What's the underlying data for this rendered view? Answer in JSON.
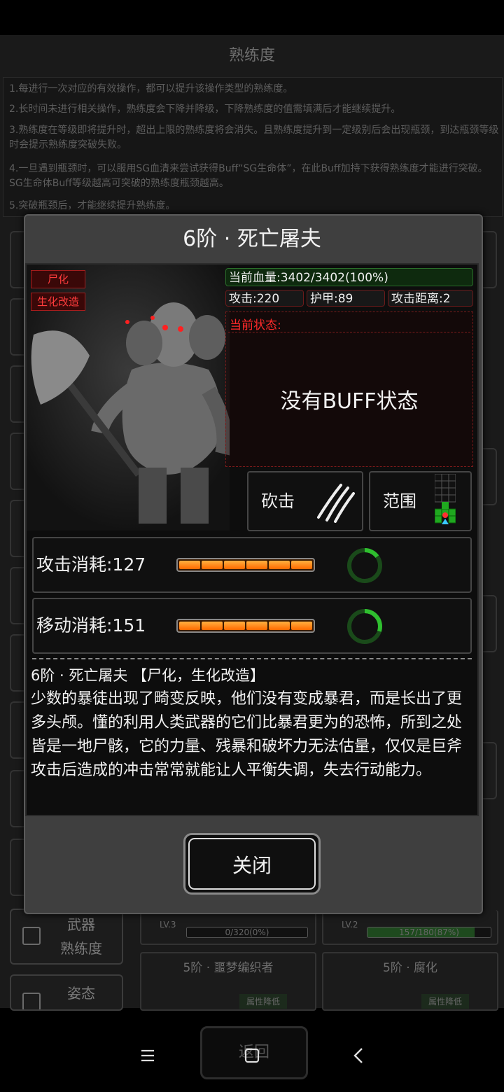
{
  "background": {
    "title": "熟练度",
    "rules": [
      "1.每进行一次对应的有效操作，都可以提升该操作类型的熟练度。",
      "2.长时间未进行相关操作，熟练度会下降并降级，下降熟练度的值需填满后才能继续提升。",
      "3.熟练度在等级即将提升时，超出上限的熟练度将会消失。且熟练度提升到一定级别后会出现瓶颈，到达瓶颈等级时会提示熟练度突破失败。",
      "4.一旦遇到瓶颈时，可以服用SG血清来尝试获得Buff“SG生命体”，在此Buff加持下获得熟练度才能进行突破。SG生命体Buff等级越高可突破的熟练度瓶颈越高。",
      "5.突破瓶颈后，才能继续提升熟练度。"
    ],
    "tabs": [
      {
        "line1": "武器",
        "line2": "熟练度"
      },
      {
        "line1": "姿态",
        "line2": ""
      }
    ],
    "cards": [
      {
        "level": "LV.3",
        "progress_text": "0/320(0%)",
        "progress": 0
      },
      {
        "level": "LV.2",
        "progress_text": "157/180(87%)",
        "progress": 0.87
      }
    ],
    "next_cards": [
      {
        "name": "5阶 · 噩梦编织者",
        "tag": "属性降低"
      },
      {
        "name": "5阶 · 腐化",
        "tag": "属性降低"
      }
    ],
    "return_label": "返回"
  },
  "modal": {
    "title": "6阶 · 死亡屠夫",
    "tags": [
      "尸化",
      "生化改造"
    ],
    "hp": "当前血量:3402/3402(100%)",
    "stats": {
      "attack": "攻击:220",
      "armor": "护甲:89",
      "range": "攻击距离:2"
    },
    "state_label": "当前状态:",
    "no_buff": "没有BUFF状态",
    "skills": {
      "attack_type": "砍击",
      "range_label": "范围"
    },
    "costs": [
      {
        "label": "攻击消耗:127",
        "ring_fill": 0.15
      },
      {
        "label": "移动消耗:151",
        "ring_fill": 0.3
      }
    ],
    "desc_title": "6阶 · 死亡屠夫 【尸化，生化改造】",
    "desc": "少数的暴徒出现了畸变反映，他们没有变成暴君，而是长出了更多头颅。懂的利用人类武器的它们比暴君更为的恐怖，所到之处皆是一地尸骸，它的力量、残暴和破坏力无法估量，仅仅是巨斧攻击后造成的冲击常常就能让人平衡失调，失去行动能力。",
    "close_label": "关闭"
  },
  "colors": {
    "accent_red": "#ff2a2a",
    "hp_green": "#2a6e2a",
    "energy_orange": "#ff8a00",
    "ring_green": "#2fbf2f"
  },
  "navbar": {
    "menu_icon": "menu-icon",
    "home_icon": "home-square-icon",
    "back_icon": "back-chevron-icon"
  }
}
